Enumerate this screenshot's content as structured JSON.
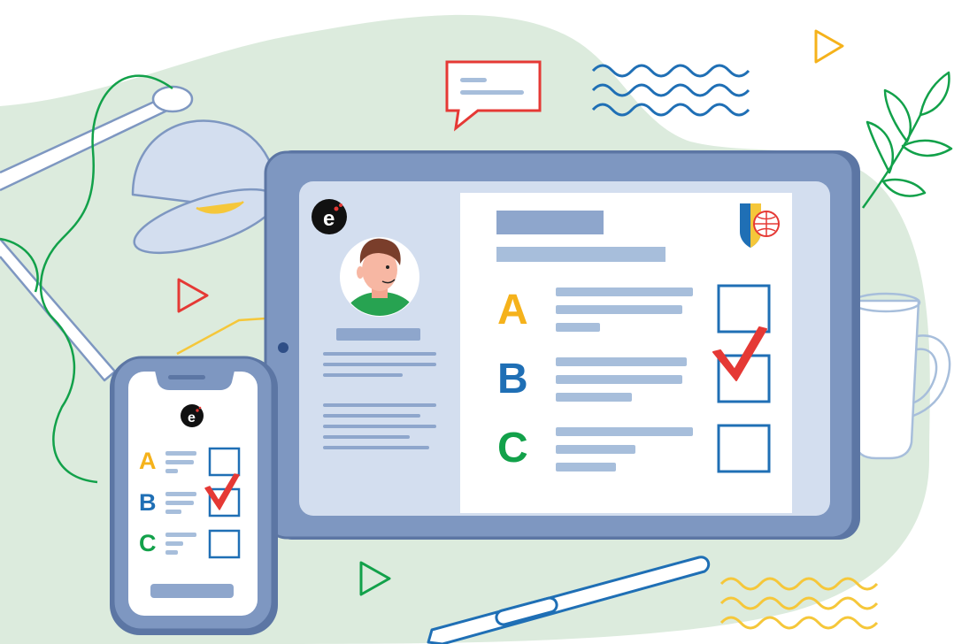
{
  "logo": {
    "letter": "e"
  },
  "tablet": {
    "options": [
      {
        "letter": "A",
        "color": "#F5B21B",
        "checked": false
      },
      {
        "letter": "B",
        "color": "#1F6FB5",
        "checked": true
      },
      {
        "letter": "C",
        "color": "#12A14A",
        "checked": false
      }
    ]
  },
  "phone": {
    "options": [
      {
        "letter": "A",
        "color": "#F5B21B",
        "checked": false
      },
      {
        "letter": "B",
        "color": "#1F6FB5",
        "checked": true
      },
      {
        "letter": "C",
        "color": "#12A14A",
        "checked": false
      }
    ]
  },
  "colors": {
    "device_frame": "#7E97C1",
    "device_frame_dark": "#5C76A4",
    "screen_bg": "#D3DEEF",
    "placeholder": "#A7BEDB",
    "check_red": "#E53935",
    "box_blue": "#1F6FB5",
    "blob_green": "#DCEBDD",
    "leaf_green": "#12A14A"
  },
  "icons": [
    "lamp-icon",
    "chat-bubble-icon",
    "wave-icon",
    "play-icon",
    "leaf-branch-icon",
    "mug-icon",
    "pen-icon",
    "avatar",
    "school-crest-icon",
    "brand-logo-icon"
  ]
}
